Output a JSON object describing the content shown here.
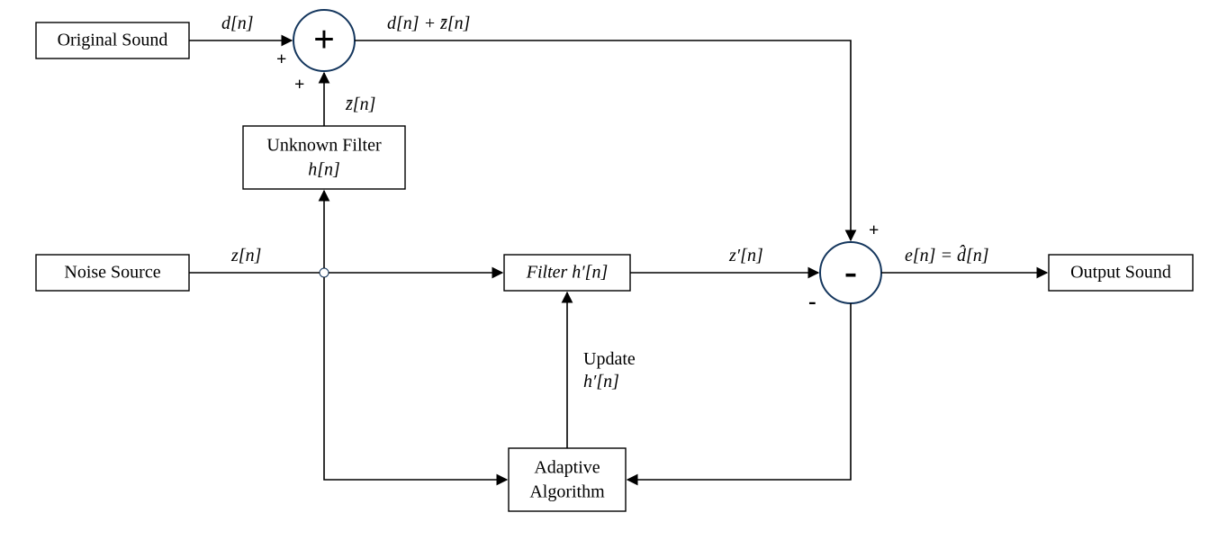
{
  "diagram": {
    "blocks": {
      "original_sound": "Original Sound",
      "noise_source": "Noise Source",
      "unknown_filter_line1": "Unknown Filter",
      "unknown_filter_line2": "h[n]",
      "filter": "Filter h′[n]",
      "adaptive_line1": "Adaptive",
      "adaptive_line2": "Algorithm",
      "output_sound": "Output Sound"
    },
    "signals": {
      "d": "d[n]",
      "z": "z[n]",
      "zbar": "z̄[n]",
      "sum": "d[n] + z̄[n]",
      "zprime": "z′[n]",
      "e": "e[n] = d̂[n]",
      "update_line1": "Update",
      "update_line2": "h′[n]"
    },
    "operators": {
      "plus": "+",
      "minus": "-"
    },
    "port_signs": {
      "sum_left": "+",
      "sum_bottom": "+",
      "diff_top": "+",
      "diff_left": "-"
    }
  }
}
